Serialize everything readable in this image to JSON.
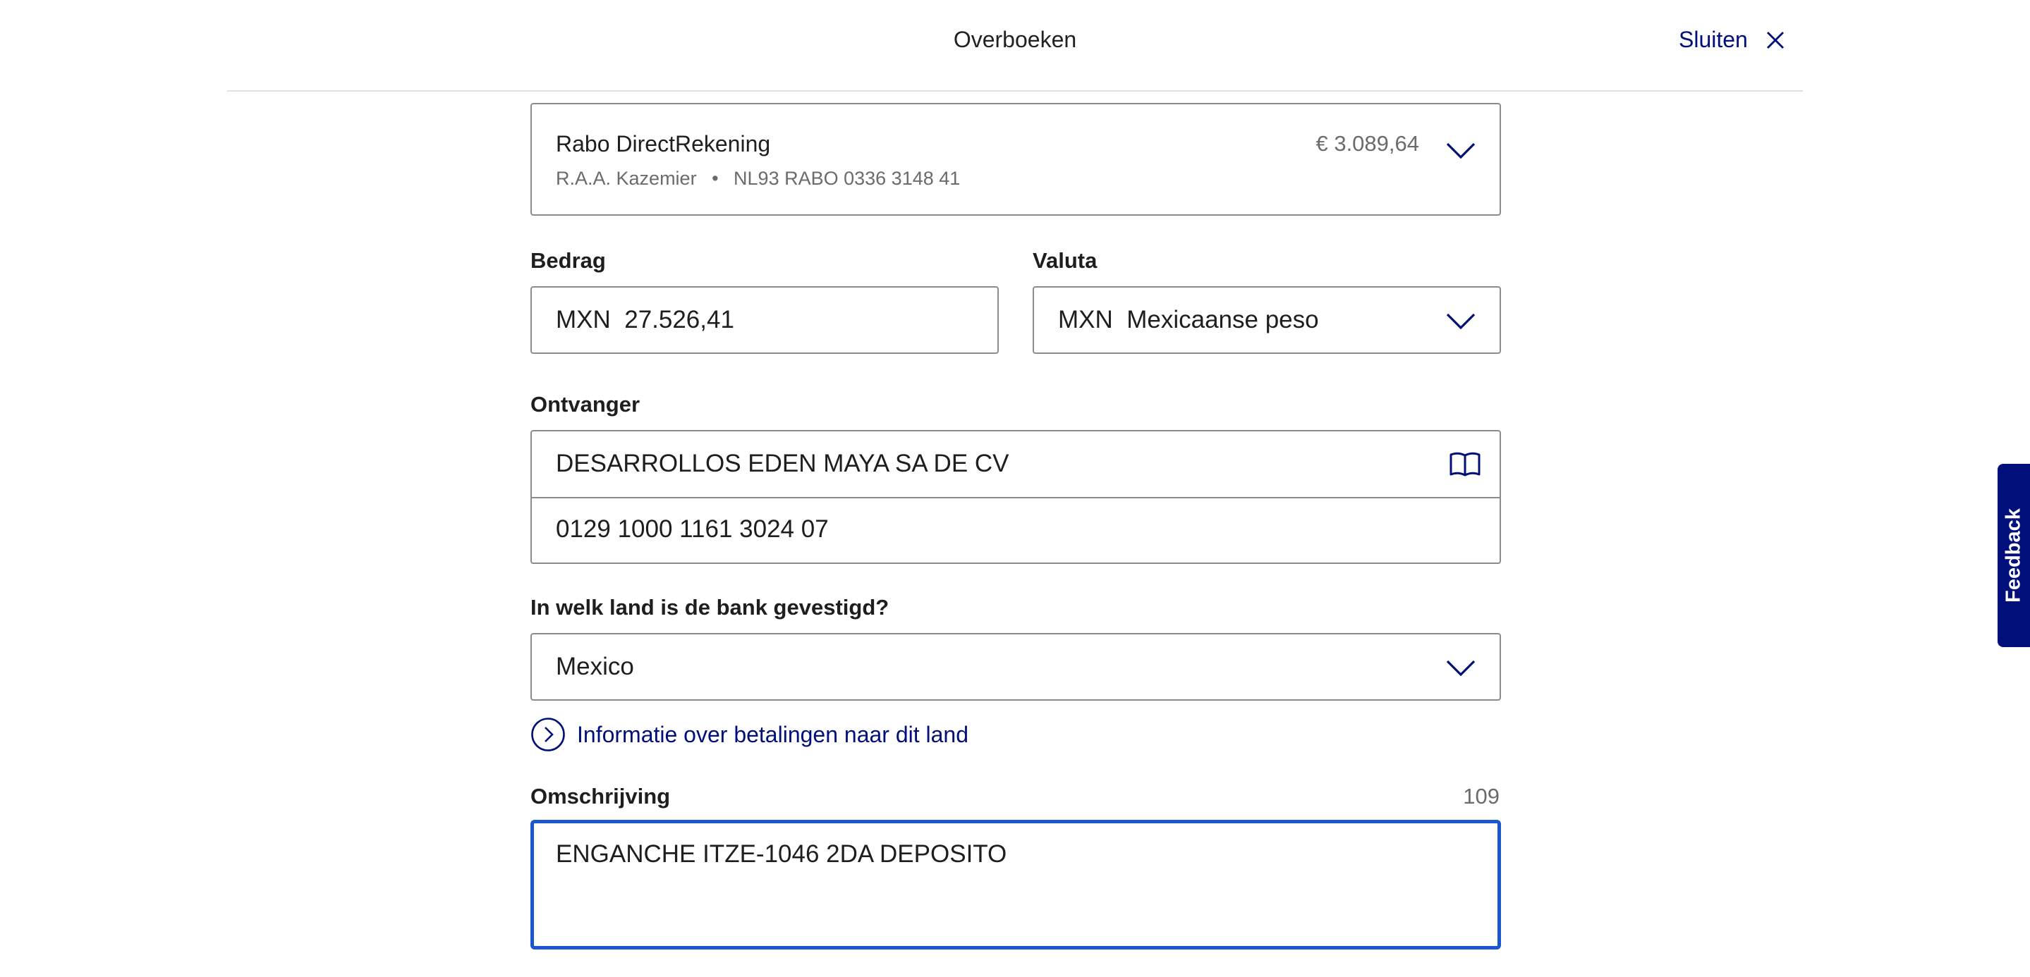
{
  "header": {
    "title": "Overboeken",
    "close_label": "Sluiten"
  },
  "account": {
    "name": "Rabo DirectRekening",
    "holder": "R.A.A. Kazemier",
    "separator": "•",
    "iban": "NL93 RABO 0336 3148 41",
    "balance": "€ 3.089,64"
  },
  "amount": {
    "label": "Bedrag",
    "value": "MXN  27.526,41"
  },
  "currency": {
    "label": "Valuta",
    "value": "MXN  Mexicaanse peso"
  },
  "recipient": {
    "label": "Ontvanger",
    "name": "DESARROLLOS EDEN MAYA SA DE CV",
    "account_number": "0129 1000 1161 3024 07"
  },
  "country": {
    "label": "In welk land is de bank gevestigd?",
    "value": "Mexico",
    "info_link": "Informatie over betalingen naar dit land"
  },
  "description": {
    "label": "Omschrijving",
    "remaining_chars": "109",
    "value": "ENGANCHE ITZE-1046 2DA DEPOSITO"
  },
  "feedback": {
    "label": "Feedback"
  },
  "icons": [
    "close-icon",
    "chevron-down-icon",
    "address-book-icon",
    "chevron-right-circle-icon"
  ],
  "colors": {
    "accent": "#000f7a",
    "focus": "#1a56d0",
    "border": "#8c8c8c"
  }
}
